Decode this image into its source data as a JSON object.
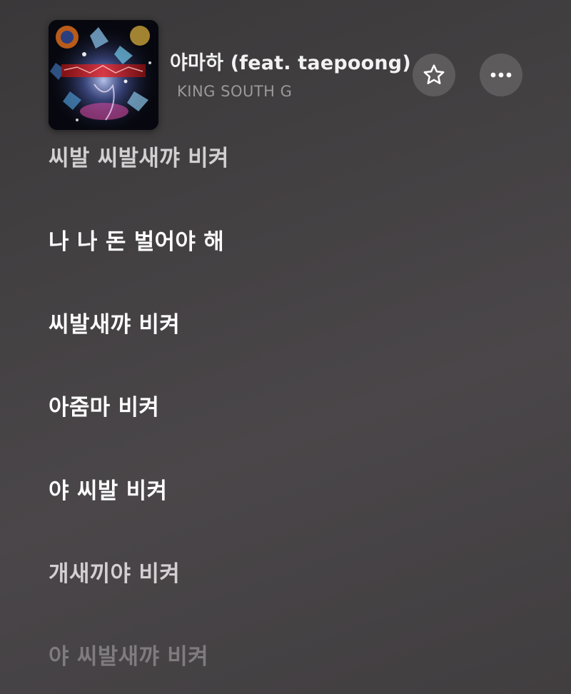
{
  "now_playing": {
    "title": "야마하 (feat. taepoong)",
    "artist": "KING SOUTH G",
    "artwork_icon": "album-artwork"
  },
  "actions": {
    "favorite_icon": "star-outline-icon",
    "more_icon": "ellipsis-icon"
  },
  "lyrics": [
    {
      "text": "씨발 씨발새꺄 비켜",
      "color": "#d2d0d1"
    },
    {
      "text": "나 나 돈 벌어야 해",
      "color": "#ffffff"
    },
    {
      "text": "씨발새꺄 비켜",
      "color": "#ffffff"
    },
    {
      "text": "아줌마 비켜",
      "color": "#ffffff"
    },
    {
      "text": "야 씨발 비켜",
      "color": "#ffffff"
    },
    {
      "text": "개새끼야 비켜",
      "color": "#d4d0d2"
    },
    {
      "text": "야 씨발새꺄 비켜",
      "color": "#7f7b7e"
    }
  ]
}
